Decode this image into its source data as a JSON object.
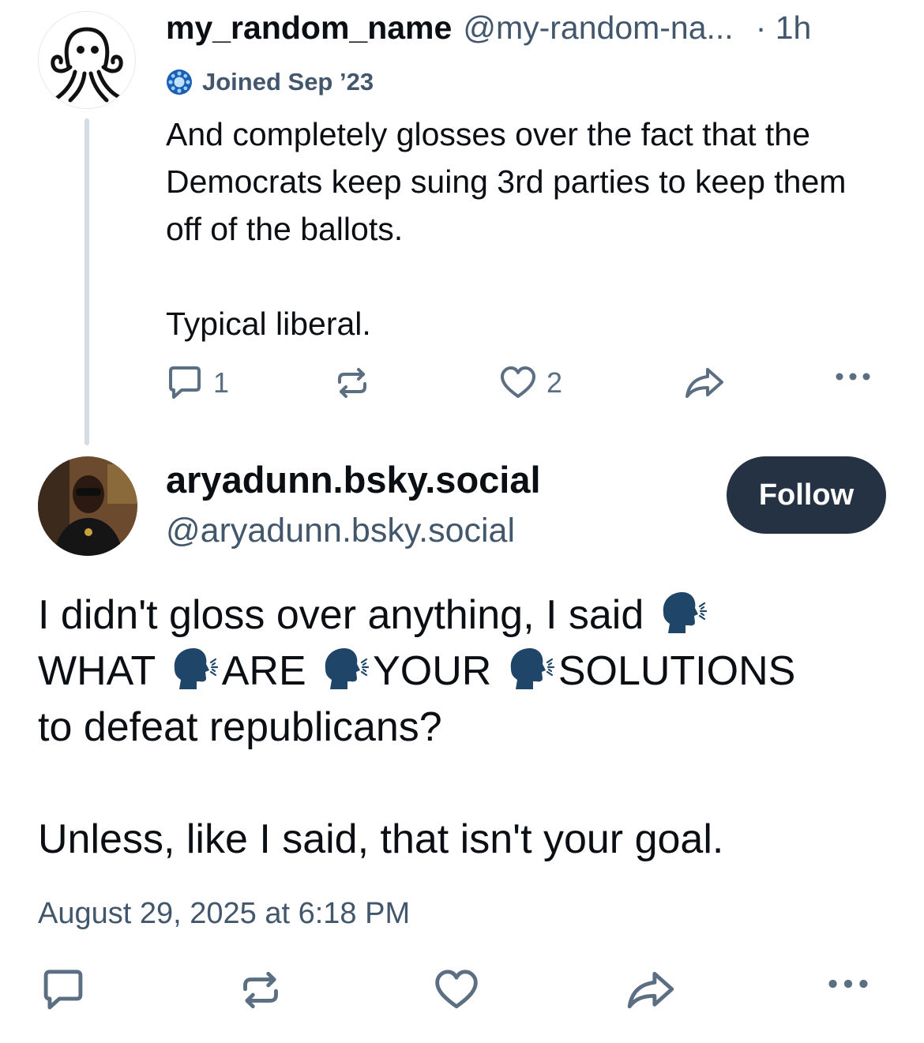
{
  "parent_post": {
    "display_name": "my_random_name",
    "handle": "@my-random-na...",
    "time": "· 1h",
    "joined": "Joined Sep ’23",
    "paragraphs": [
      "And completely glosses over the fact that the Democrats keep suing 3rd parties to keep them off of the ballots.",
      "Typical liberal."
    ],
    "reply_count": "1",
    "like_count": "2"
  },
  "reply_post": {
    "display_name": "aryadunn.bsky.social",
    "handle": "@aryadunn.bsky.social",
    "follow_label": "Follow",
    "line1_text": "I didn't gloss over anything, I said",
    "word1": "WHAT",
    "word2": "ARE",
    "word3": "YOUR",
    "word4": "SOLUTIONS",
    "line3_text": "to defeat republicans?",
    "paragraph2": "Unless, like I said, that isn't your goal.",
    "timestamp": "August 29, 2025 at 6:18 PM"
  },
  "icons": {
    "joined": "new-user-badge-icon",
    "speaking": "speaking-head-icon",
    "reply": "reply-icon",
    "repost": "repost-icon",
    "like": "heart-icon",
    "share": "share-icon",
    "more": "more-icon"
  },
  "colors": {
    "follow_button": "#253244",
    "muted_text": "#42576c",
    "action_icon": "#5b6e82",
    "thread_line": "#d4dbe2"
  }
}
